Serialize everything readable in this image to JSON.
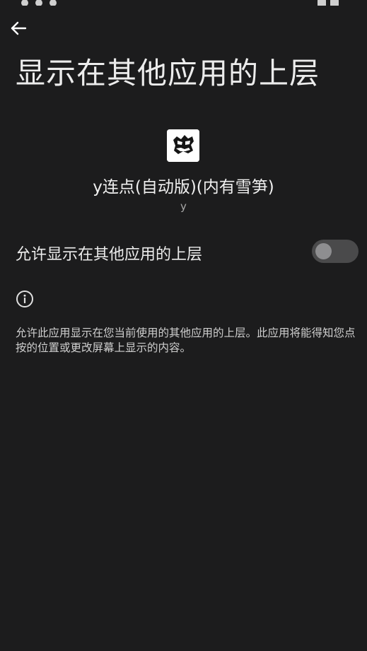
{
  "header": {
    "title": "显示在其他应用的上层",
    "icons": {
      "back": "arrow-back-icon"
    }
  },
  "app": {
    "icon": "app-icon",
    "name": "y连点(自动版)(内有雪笋)",
    "version": "y"
  },
  "permission": {
    "label": "允许显示在其他应用的上层",
    "enabled": false
  },
  "info": {
    "icon": "info-icon",
    "text": "允许此应用显示在您当前使用的其他应用的上层。此应用将能得知您点按的位置或更改屏幕上显示的内容。"
  },
  "colors": {
    "background": "#1c1c1d",
    "toggle_track_off": "#4a4a4b",
    "toggle_thumb_off": "#8e8e90"
  }
}
